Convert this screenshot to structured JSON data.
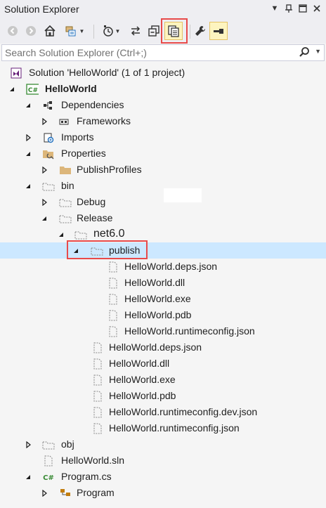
{
  "window": {
    "title": "Solution Explorer"
  },
  "search": {
    "placeholder": "Search Solution Explorer (Ctrl+;)"
  },
  "colors": {
    "selection": "#cce8ff",
    "highlight_box": "#e84a4a",
    "csharp_green": "#388a34",
    "folder": "#dcb67a"
  },
  "tree": {
    "solution": "Solution 'HelloWorld' (1 of 1 project)",
    "project": "HelloWorld",
    "dependencies": "Dependencies",
    "frameworks": "Frameworks",
    "imports": "Imports",
    "properties": "Properties",
    "publish_profiles": "PublishProfiles",
    "bin": "bin",
    "debug": "Debug",
    "release": "Release",
    "net": "net6.0",
    "publish": "publish",
    "publish_files": [
      "HelloWorld.deps.json",
      "HelloWorld.dll",
      "HelloWorld.exe",
      "HelloWorld.pdb",
      "HelloWorld.runtimeconfig.json"
    ],
    "net_files": [
      "HelloWorld.deps.json",
      "HelloWorld.dll",
      "HelloWorld.exe",
      "HelloWorld.pdb",
      "HelloWorld.runtimeconfig.dev.json",
      "HelloWorld.runtimeconfig.json"
    ],
    "obj": "obj",
    "sln": "HelloWorld.sln",
    "program_cs": "Program.cs",
    "program": "Program",
    "csharp_badge": "C#"
  }
}
